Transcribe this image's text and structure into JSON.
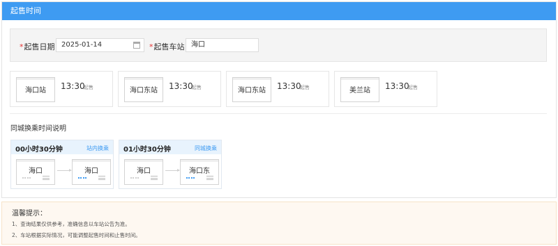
{
  "panel": {
    "title": "起售时间"
  },
  "query": {
    "date_label": "起售日期",
    "date_value": "2025-01-14",
    "station_label": "起售车站",
    "station_value": "海口"
  },
  "cards": [
    {
      "station": "海口站",
      "time": "13:30",
      "tag": "起售"
    },
    {
      "station": "海口东站",
      "time": "13:30",
      "tag": "起售"
    },
    {
      "station": "海口东站",
      "time": "13:30",
      "tag": "起售"
    },
    {
      "station": "美兰站",
      "time": "13:30",
      "tag": "起售"
    }
  ],
  "transfer": {
    "title": "同城换乘时间说明",
    "items": [
      {
        "duration": "00小时30分钟",
        "type": "站内换乘",
        "from": "海口",
        "to": "海口",
        "colors": [
          "#cfcfcf",
          "#3e9bf2"
        ]
      },
      {
        "duration": "01小时30分钟",
        "type": "同城换乘",
        "from": "海口",
        "to": "海口东",
        "colors": [
          "#cfcfcf",
          "#3e9bf2"
        ]
      }
    ]
  },
  "notice": {
    "title": "温馨提示：",
    "lines": [
      "1、查询结果仅供参考，准确信息以车站公告为准。",
      "2、车站根据实际情况，可能调整起售时间和止售时间。"
    ]
  }
}
